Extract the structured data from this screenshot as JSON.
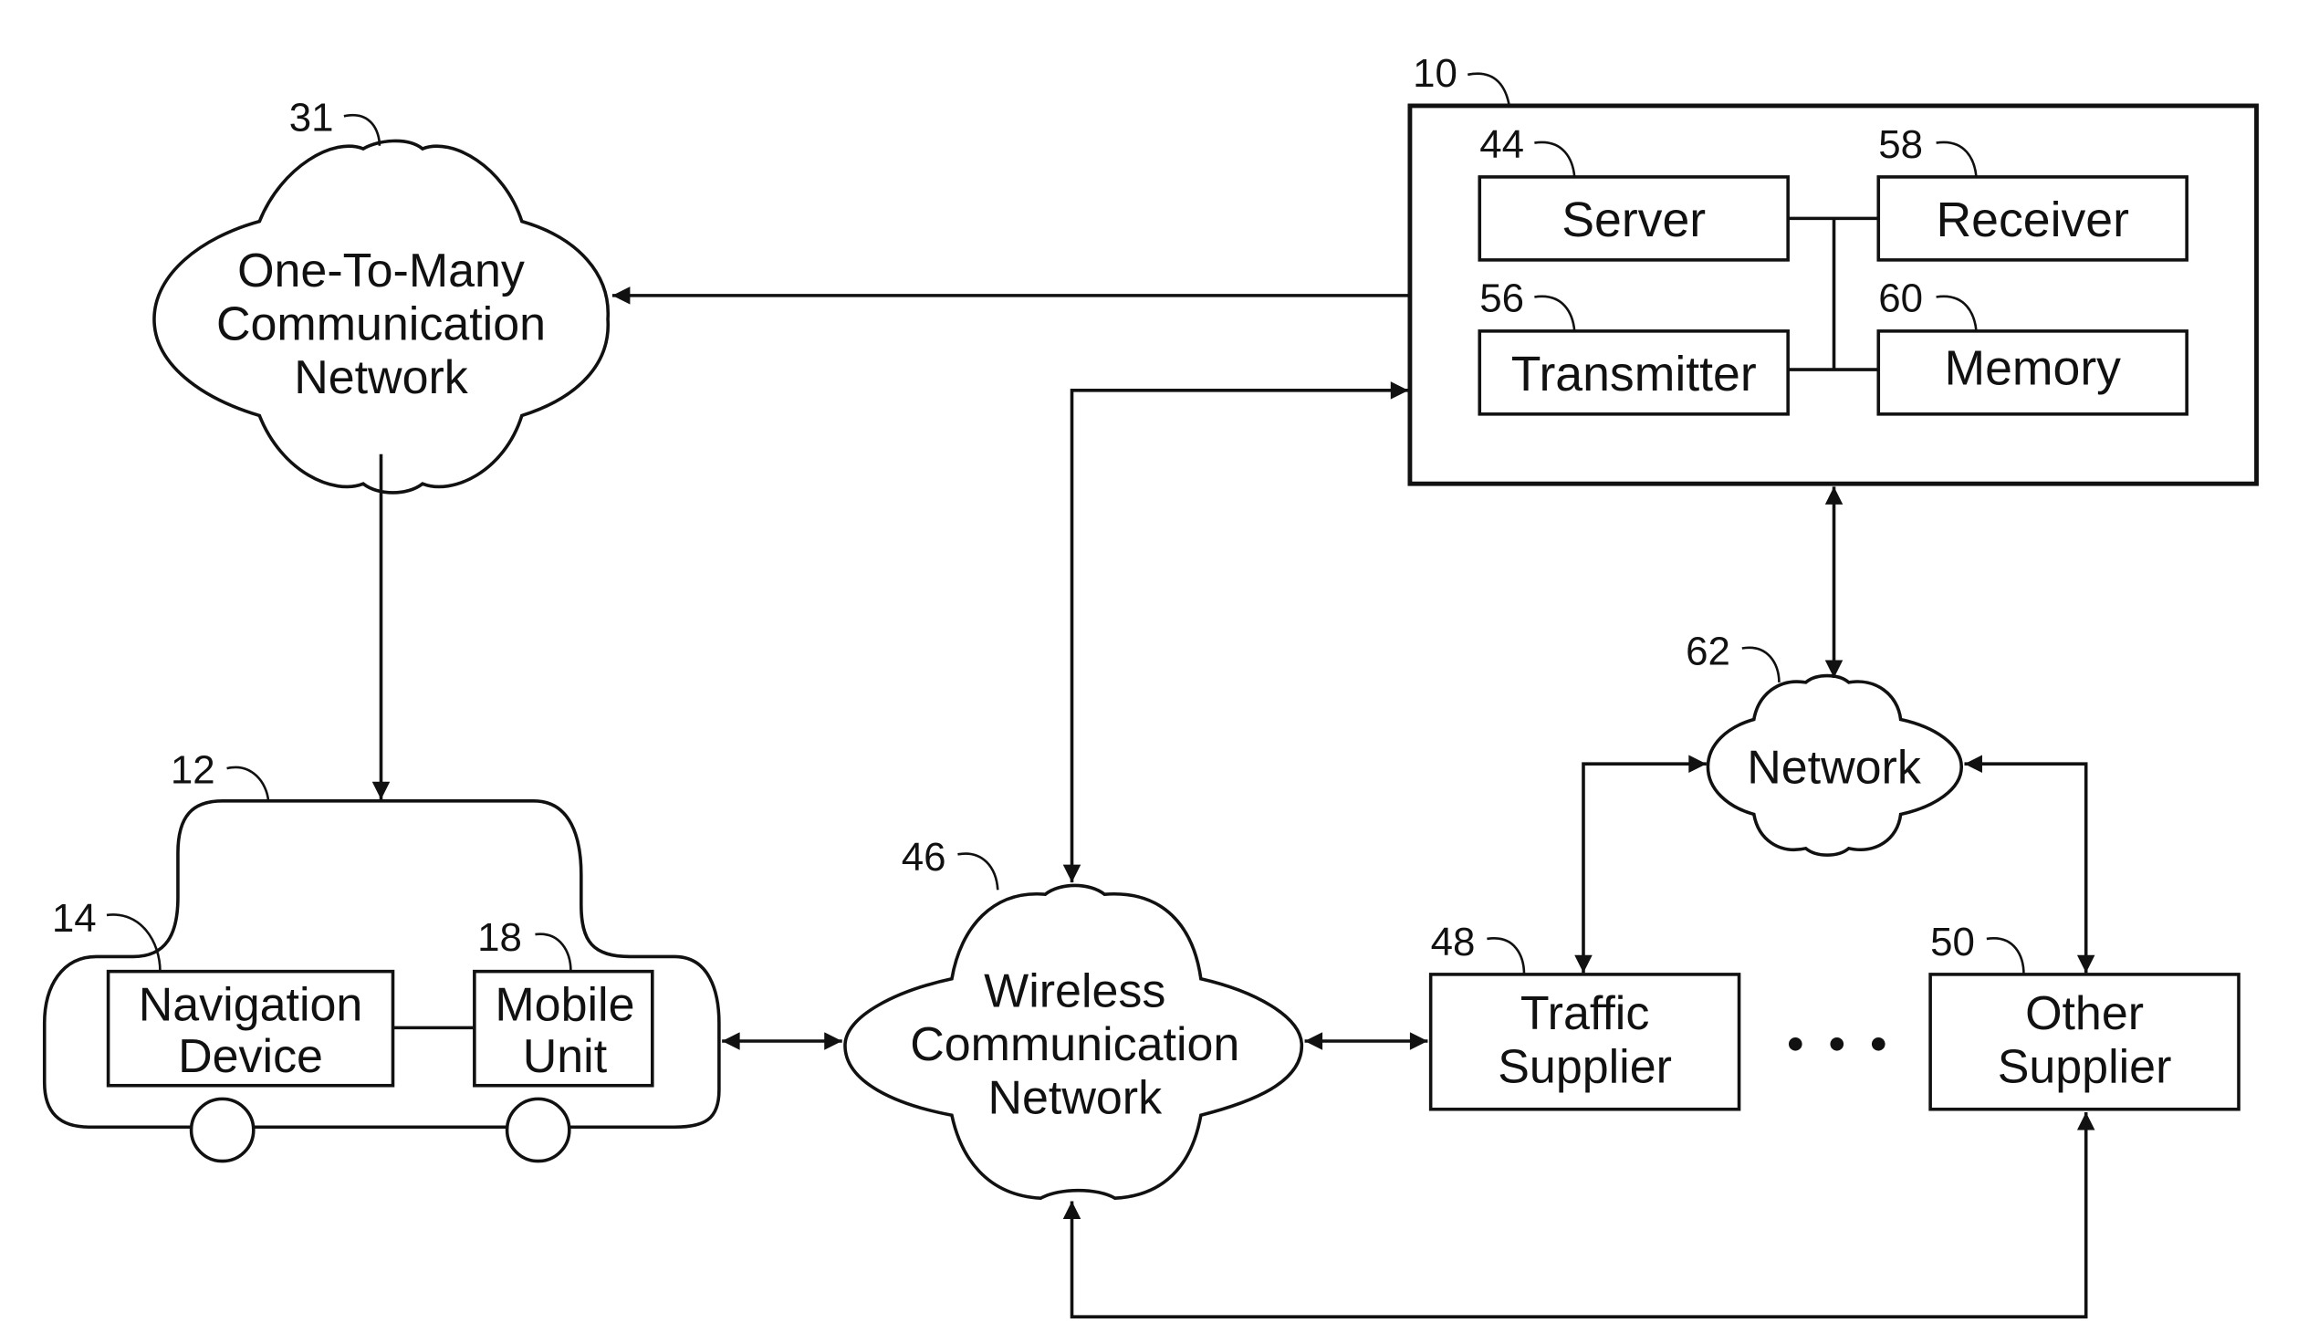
{
  "diagram": {
    "type": "block-diagram",
    "colors": {
      "line": "#111111",
      "background": "#ffffff"
    },
    "nodes": {
      "central": {
        "ref": "10",
        "children": {
          "server": {
            "ref": "44",
            "label": "Server"
          },
          "receiver": {
            "ref": "58",
            "label": "Receiver"
          },
          "transmitter": {
            "ref": "56",
            "label": "Transmitter"
          },
          "memory": {
            "ref": "60",
            "label": "Memory"
          }
        }
      },
      "one_to_many": {
        "ref": "31",
        "lines": [
          "One-To-Many",
          "Communication",
          "Network"
        ]
      },
      "vehicle": {
        "ref": "12"
      },
      "navigation_device": {
        "ref": "14",
        "lines": [
          "Navigation",
          "Device"
        ]
      },
      "mobile_unit": {
        "ref": "18",
        "lines": [
          "Mobile",
          "Unit"
        ]
      },
      "wireless": {
        "ref": "46",
        "lines": [
          "Wireless",
          "Communication",
          "Network"
        ]
      },
      "network": {
        "ref": "62",
        "label": "Network"
      },
      "traffic_supplier": {
        "ref": "48",
        "lines": [
          "Traffic",
          "Supplier"
        ]
      },
      "other_supplier": {
        "ref": "50",
        "lines": [
          "Other",
          "Supplier"
        ]
      },
      "ellipsis": "..."
    },
    "edges": [
      {
        "from": "central",
        "to": "one_to_many",
        "direction": "one-way"
      },
      {
        "from": "one_to_many",
        "to": "vehicle",
        "direction": "one-way"
      },
      {
        "from": "mobile_unit",
        "to": "wireless",
        "direction": "two-way"
      },
      {
        "from": "wireless",
        "to": "central",
        "direction": "two-way"
      },
      {
        "from": "wireless",
        "to": "traffic_supplier",
        "direction": "two-way"
      },
      {
        "from": "central",
        "to": "network",
        "direction": "two-way"
      },
      {
        "from": "network",
        "to": "traffic_supplier",
        "direction": "two-way"
      },
      {
        "from": "network",
        "to": "other_supplier",
        "direction": "two-way"
      },
      {
        "from": "other_supplier",
        "to": "wireless",
        "direction": "two-way"
      },
      {
        "from": "navigation_device",
        "to": "mobile_unit",
        "direction": "link"
      },
      {
        "from": "server",
        "to": "receiver",
        "direction": "bus"
      },
      {
        "from": "transmitter",
        "to": "memory",
        "direction": "bus"
      }
    ]
  }
}
